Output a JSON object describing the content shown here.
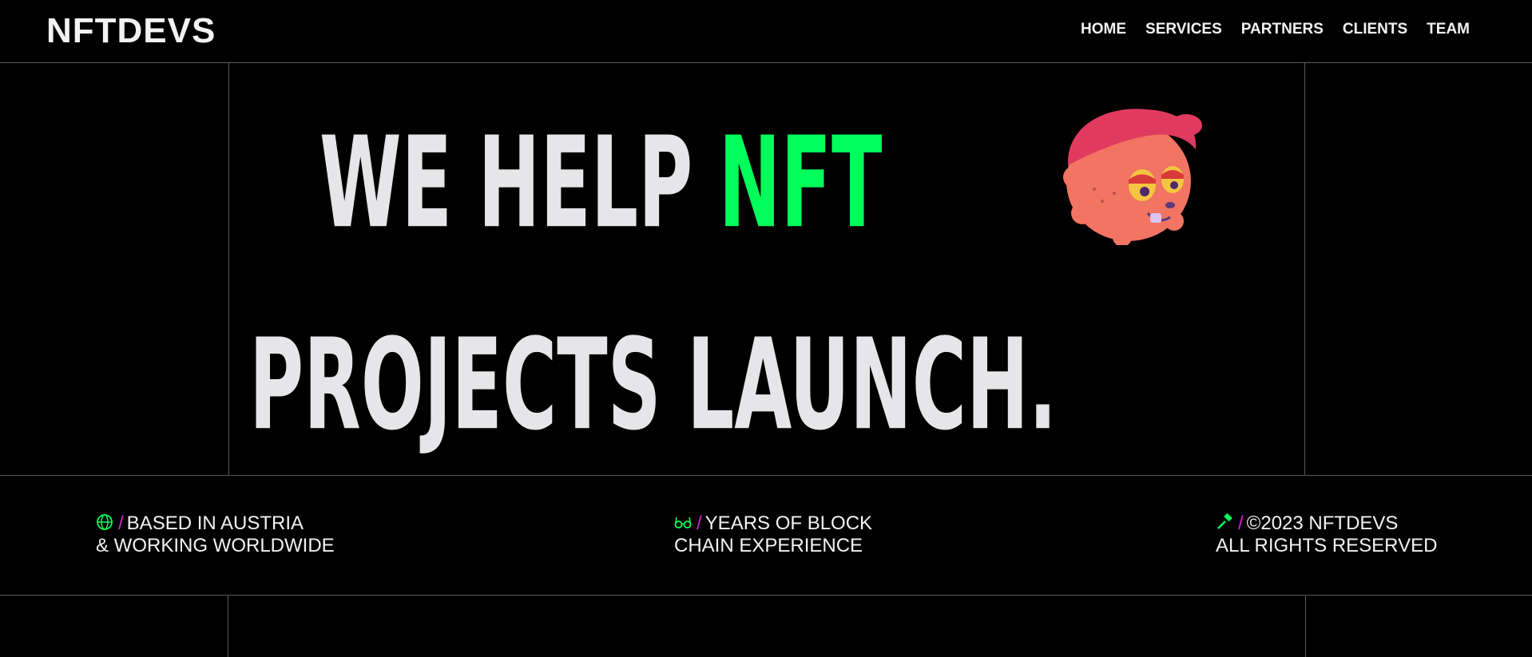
{
  "header": {
    "logo": "NFTDEVS",
    "nav": [
      "HOME",
      "SERVICES",
      "PARTNERS",
      "CLIENTS",
      "TEAM"
    ]
  },
  "hero": {
    "line1_prefix": "WE HELP ",
    "line1_accent": "NFT",
    "line2": "PROJECTS LAUNCH.",
    "accent_color": "#00ff5a",
    "mascot_icon": "cartoon-head-mascot"
  },
  "info": [
    {
      "icon": "globe-icon",
      "separator": "/",
      "line1": "BASED IN AUSTRIA",
      "line2": "& WORKING WORLDWIDE"
    },
    {
      "icon": "glasses-icon",
      "separator": "/",
      "line1": "YEARS OF BLOCK",
      "line2": "CHAIN EXPERIENCE"
    },
    {
      "icon": "hammer-icon",
      "separator": "/",
      "line1": "©2023 NFTDEVS",
      "line2": "ALL RIGHTS RESERVED"
    }
  ],
  "colors": {
    "background": "#000000",
    "text": "#e6e5e8",
    "accent": "#00ff5a",
    "separator": "#d81bd8",
    "divider": "#5a5a5a"
  }
}
